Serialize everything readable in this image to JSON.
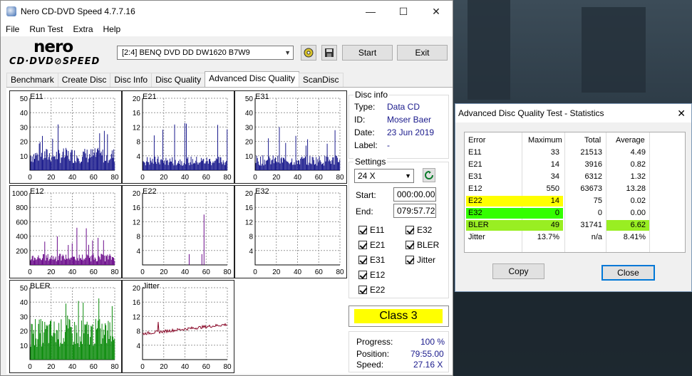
{
  "window": {
    "title": "Nero CD-DVD Speed 4.7.7.16",
    "minimize": "—",
    "maximize": "☐",
    "close": "✕"
  },
  "menu": [
    "File",
    "Run Test",
    "Extra",
    "Help"
  ],
  "logo": {
    "line1": "nero",
    "line2": "CD·DVD⊘SPEED"
  },
  "toolbar": {
    "drive": "[2:4]   BENQ DVD DD DW1620 B7W9",
    "start_label": "Start",
    "exit_label": "Exit"
  },
  "tabs": [
    "Benchmark",
    "Create Disc",
    "Disc Info",
    "Disc Quality",
    "Advanced Disc Quality",
    "ScanDisc"
  ],
  "active_tab": "Advanced Disc Quality",
  "graphs": [
    {
      "label": "E11",
      "yticks": [
        "50",
        "40",
        "30",
        "20",
        "10"
      ],
      "xticks": [
        "0",
        "20",
        "40",
        "60",
        "80"
      ],
      "color": "#1a1a8c"
    },
    {
      "label": "E21",
      "yticks": [
        "20",
        "16",
        "12",
        "8",
        "4"
      ],
      "xticks": [
        "0",
        "20",
        "40",
        "60",
        "80"
      ],
      "color": "#1a1a8c"
    },
    {
      "label": "E31",
      "yticks": [
        "50",
        "40",
        "30",
        "20",
        "10"
      ],
      "xticks": [
        "0",
        "20",
        "40",
        "60",
        "80"
      ],
      "color": "#1a1a8c"
    },
    {
      "label": "E12",
      "yticks": [
        "1000",
        "800",
        "600",
        "400",
        "200"
      ],
      "xticks": [
        "0",
        "20",
        "40",
        "60",
        "80"
      ],
      "color": "#6a0a8a"
    },
    {
      "label": "E22",
      "yticks": [
        "20",
        "16",
        "12",
        "8",
        "4"
      ],
      "xticks": [
        "0",
        "20",
        "40",
        "60",
        "80"
      ],
      "color": "#6a0a8a"
    },
    {
      "label": "E32",
      "yticks": [
        "20",
        "16",
        "12",
        "8",
        "4"
      ],
      "xticks": [
        "0",
        "20",
        "40",
        "60",
        "80"
      ],
      "color": "#6a0a8a"
    },
    {
      "label": "BLER",
      "yticks": [
        "50",
        "40",
        "30",
        "20",
        "10"
      ],
      "xticks": [
        "0",
        "20",
        "40",
        "60",
        "80"
      ],
      "color": "#0a8a0a"
    },
    {
      "label": "Jitter",
      "yticks": [
        "20",
        "16",
        "12",
        "8",
        "4"
      ],
      "xticks": [
        "0",
        "20",
        "40",
        "60",
        "80"
      ],
      "color": "#8a0a2a"
    }
  ],
  "disc_info": {
    "title": "Disc info",
    "type_label": "Type:",
    "type": "Data CD",
    "id_label": "ID:",
    "id": "Moser Baer",
    "date_label": "Date:",
    "date": "23 Jun 2019",
    "label_label": "Label:",
    "label": "-"
  },
  "settings": {
    "title": "Settings",
    "speed": "24 X",
    "start_label": "Start:",
    "start": "000:00.00",
    "end_label": "End:",
    "end": "079:57.72",
    "checks": [
      {
        "label": "E11",
        "checked": true
      },
      {
        "label": "E32",
        "checked": true
      },
      {
        "label": "E21",
        "checked": true
      },
      {
        "label": "BLER",
        "checked": true
      },
      {
        "label": "E31",
        "checked": true
      },
      {
        "label": "Jitter",
        "checked": true
      },
      {
        "label": "E12",
        "checked": true
      },
      {
        "label": "E22",
        "checked": true
      }
    ]
  },
  "class_label": "Class 3",
  "progress": {
    "progress_label": "Progress:",
    "progress": "100 %",
    "position_label": "Position:",
    "position": "79:55.00",
    "speed_label": "Speed:",
    "speed": "27.16 X"
  },
  "stats": {
    "title": "Advanced Disc Quality Test - Statistics",
    "close": "✕",
    "headers": [
      "Error",
      "Maximum",
      "Total",
      "Average"
    ],
    "rows": [
      {
        "error": "E11",
        "maximum": "33",
        "total": "21513",
        "average": "4.49"
      },
      {
        "error": "E21",
        "maximum": "14",
        "total": "3916",
        "average": "0.82"
      },
      {
        "error": "E31",
        "maximum": "34",
        "total": "6312",
        "average": "1.32"
      },
      {
        "error": "E12",
        "maximum": "550",
        "total": "63673",
        "average": "13.28"
      },
      {
        "error": "E22",
        "maximum": "14",
        "total": "75",
        "average": "0.02"
      },
      {
        "error": "E32",
        "maximum": "0",
        "total": "0",
        "average": "0.00"
      },
      {
        "error": "BLER",
        "maximum": "49",
        "total": "31741",
        "average": "6.62"
      },
      {
        "error": "Jitter",
        "maximum": "13.7%",
        "total": "n/a",
        "average": "8.41%"
      }
    ],
    "highlight_colors": {
      "yellow": "#ffff00",
      "green": "#33ff00",
      "lime": "#99ee22"
    },
    "copy_label": "Copy",
    "close_label": "Close"
  }
}
